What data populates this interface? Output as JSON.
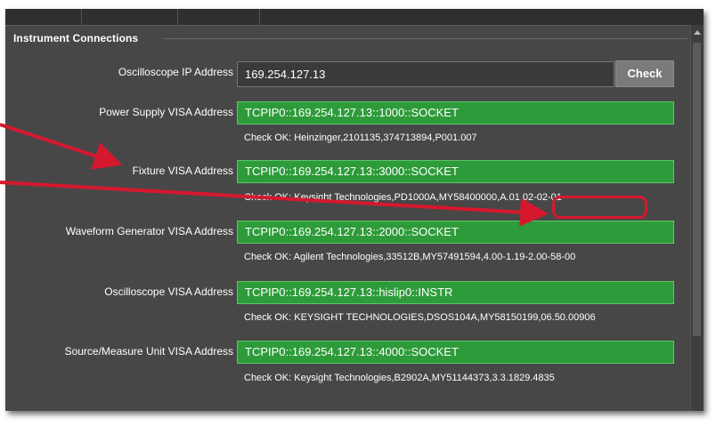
{
  "group": {
    "title": "Instrument Connections"
  },
  "oscilloscope_ip": {
    "label": "Oscilloscope IP Address",
    "value": "169.254.127.13",
    "check_label": "Check"
  },
  "power_supply": {
    "label": "Power Supply VISA Address",
    "value": "TCPIP0::169.254.127.13::1000::SOCKET",
    "status": "Check OK: Heinzinger,2101135,374713894,P001.007"
  },
  "fixture": {
    "label": "Fixture VISA Address",
    "value": "TCPIP0::169.254.127.13::3000::SOCKET",
    "status": "Check OK: Keysight Technologies,PD1000A,MY58400000,A.01.02-02-01"
  },
  "waveform_generator": {
    "label": "Waveform Generator VISA Address",
    "value": "TCPIP0::169.254.127.13::2000::SOCKET",
    "status": "Check OK: Agilent Technologies,33512B,MY57491594,4.00-1.19-2.00-58-00"
  },
  "oscilloscope_visa": {
    "label": "Oscilloscope VISA Address",
    "value": "TCPIP0::169.254.127.13::hislip0::INSTR",
    "status": "Check OK: KEYSIGHT TECHNOLOGIES,DSOS104A,MY58150199,06.50.00906"
  },
  "smu": {
    "label": "Source/Measure Unit VISA Address",
    "value": "TCPIP0::169.254.127.13::4000::SOCKET",
    "status": "Check OK: Keysight Technologies,B2902A,MY51144373,3.3.1829.4835"
  },
  "colors": {
    "panel": "#474747",
    "field_green": "#2e9b3a",
    "annotation_red": "#d6182e"
  }
}
